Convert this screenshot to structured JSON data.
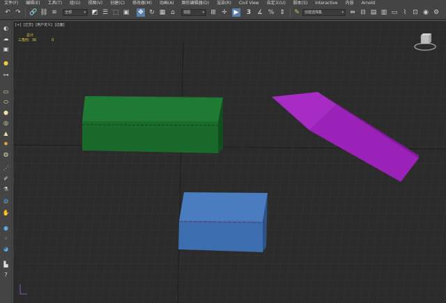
{
  "menubar": {
    "items": [
      "文件(F)",
      "编辑(E)",
      "工具(T)",
      "组(G)",
      "视图(V)",
      "创建(C)",
      "修改器(M)",
      "动画(A)",
      "图形编辑器(D)",
      "渲染(R)",
      "Civil View",
      "自定义(U)",
      "脚本(S)",
      "Interactive",
      "内容",
      "Arnold"
    ]
  },
  "toolbar": {
    "selection_filter": "全部",
    "reference_coord": "视图",
    "named_selection_placeholder": "创建选择集",
    "icons": [
      "undo-icon",
      "redo-icon",
      "link-icon",
      "unlink-icon",
      "bind-space-warp-icon",
      "select-object-icon",
      "select-by-name-icon",
      "rect-selection-region-icon",
      "window-crossing-icon",
      "select-move-icon",
      "select-rotate-icon",
      "select-scale-icon",
      "use-pivot-center-icon",
      "select-manipulate-icon",
      "snap-3d-icon",
      "angle-snap-icon",
      "percent-snap-icon",
      "spinner-snap-icon",
      "edit-named-selection-icon",
      "mirror-icon",
      "align-icon",
      "toggle-scene-explorer-icon",
      "toggle-layer-explorer-icon",
      "ribbon-icon",
      "curve-editor-icon",
      "schematic-view-icon",
      "material-editor-icon",
      "render-setup-icon",
      "rendered-frame-window-icon",
      "render-production-icon"
    ]
  },
  "viewport": {
    "label_parts": [
      "[+]",
      "[正交]",
      "[用户定义]",
      "[边面]"
    ],
    "stats": {
      "total_label": "总计",
      "triangles_label": "三角形:",
      "triangles_value": "36",
      "triangles_total": "0"
    }
  },
  "scene": {
    "objects": [
      {
        "name": "green-box",
        "color": "#1e6b2e"
      },
      {
        "name": "purple-wedge",
        "color": "#9b22b8"
      },
      {
        "name": "blue-box",
        "color": "#3d6eb0"
      }
    ]
  },
  "colors": {
    "ui_bg": "#444444",
    "viewport_bg": "#2b2b2b",
    "active_tool": "#5a7fa8",
    "stats_text": "#e8d040"
  }
}
